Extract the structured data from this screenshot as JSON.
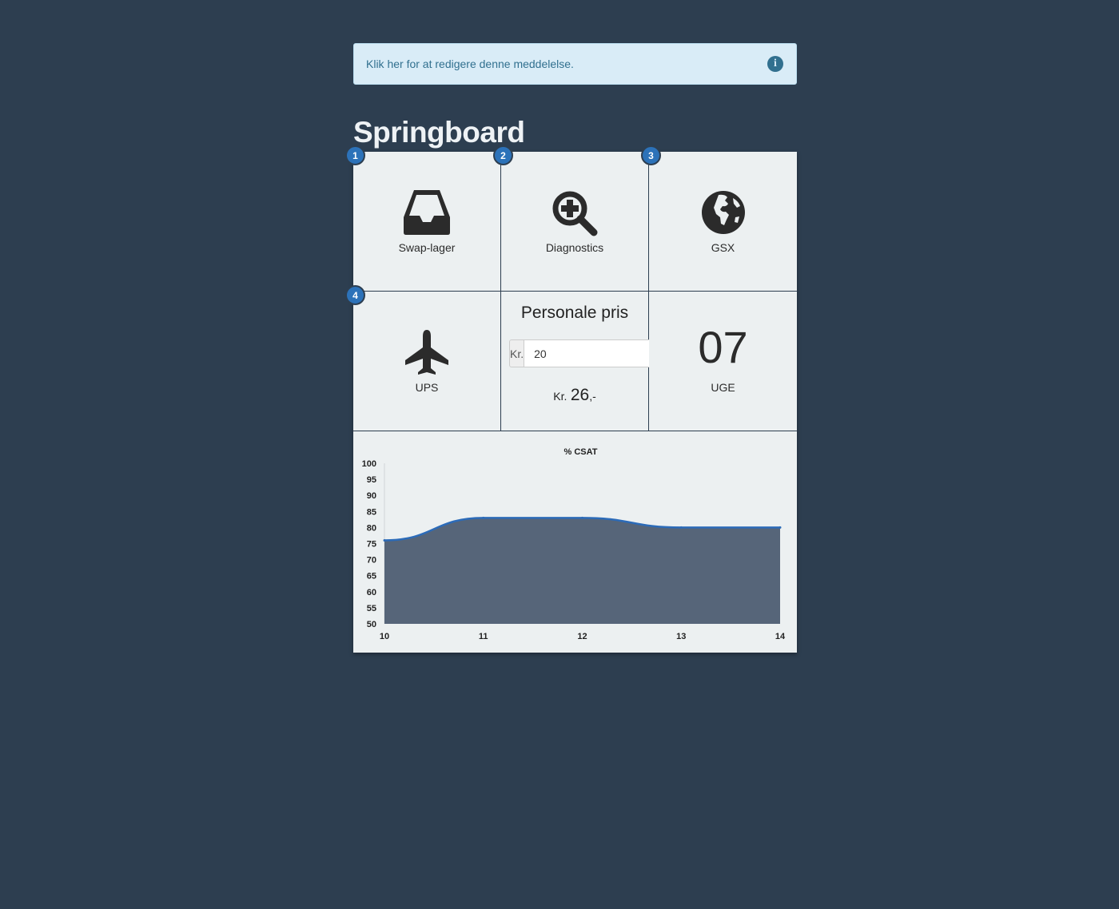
{
  "notice": {
    "text": "Klik her for at redigere denne meddelelse.",
    "icon": "info-icon"
  },
  "page_title": "Springboard",
  "tiles": [
    {
      "badge": "1",
      "label": "Swap-lager",
      "icon": "inbox-icon"
    },
    {
      "badge": "2",
      "label": "Diagnostics",
      "icon": "search-plus-icon"
    },
    {
      "badge": "3",
      "label": "GSX",
      "icon": "globe-icon"
    },
    {
      "badge": "4",
      "label": "UPS",
      "icon": "plane-icon"
    }
  ],
  "staff_price": {
    "title": "Personale pris",
    "currency_addon": "Kr.",
    "input_value": "20",
    "result_currency": "Kr.",
    "result_value": "26",
    "result_suffix": ",-"
  },
  "week": {
    "number": "07",
    "label": "UGE"
  },
  "colors": {
    "background": "#2d3e50",
    "tile": "#ecf0f1",
    "badge": "#2c72b9",
    "area_fill": "#566579",
    "line": "#2c6bb8"
  },
  "chart_data": {
    "type": "area",
    "title": "% CSAT",
    "x": [
      10,
      11,
      12,
      13,
      14
    ],
    "values": [
      76,
      83,
      83,
      80,
      80
    ],
    "ylim": [
      50,
      100
    ],
    "yticks": [
      100,
      95,
      90,
      85,
      80,
      75,
      70,
      65,
      60,
      55,
      50
    ],
    "xticks": [
      10,
      11,
      12,
      13,
      14
    ],
    "grid": false,
    "legend": "none"
  }
}
